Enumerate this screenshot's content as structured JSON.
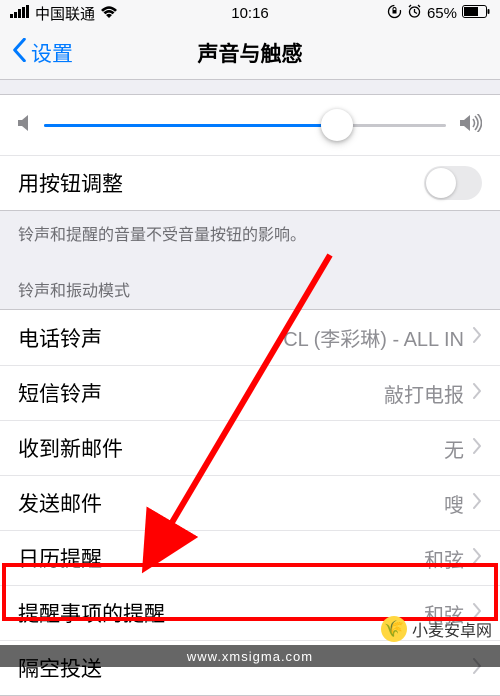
{
  "status": {
    "signal_label": "signal-bars",
    "carrier": "中国联通",
    "wifi_label": "wifi-icon",
    "time": "10:16",
    "lock_label": "lock-icon",
    "alarm_label": "alarm-icon",
    "battery_pct": "65%",
    "battery_label": "battery-icon"
  },
  "nav": {
    "back_label": "设置",
    "title": "声音与触感"
  },
  "volume": {
    "slider_value": 73
  },
  "toggle_row": {
    "label": "用按钮调整"
  },
  "footer1": "铃声和提醒的音量不受音量按钮的影响。",
  "header1": "铃声和振动模式",
  "rows": [
    {
      "label": "电话铃声",
      "value": "CL (李彩琳) - ALL IN"
    },
    {
      "label": "短信铃声",
      "value": "敲打电报"
    },
    {
      "label": "收到新邮件",
      "value": "无"
    },
    {
      "label": "发送邮件",
      "value": "嗖"
    },
    {
      "label": "日历提醒",
      "value": "和弦"
    },
    {
      "label": "提醒事项的提醒",
      "value": "和弦"
    },
    {
      "label": "隔空投送",
      "value": ""
    }
  ],
  "watermark": {
    "brand": "小麦安卓网",
    "url": "www.xmsigma.com"
  }
}
